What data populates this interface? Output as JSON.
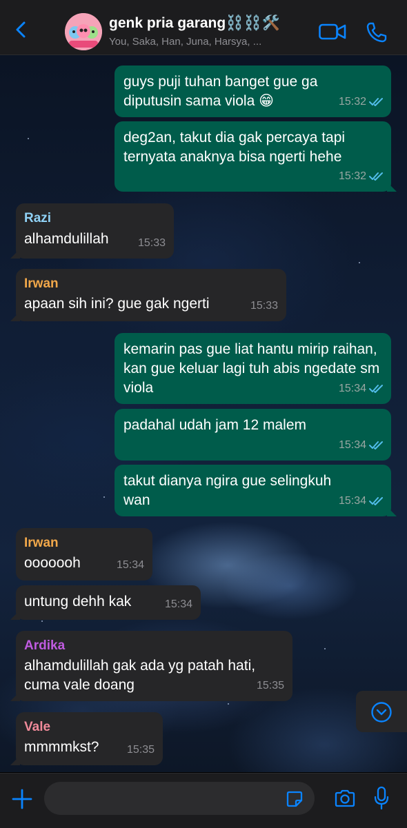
{
  "header": {
    "title": "genk pria garang⛓️⛓️🛠️",
    "subtitle": "You, Saka, Han, Juna, Harsya, ...",
    "icons": [
      "back-chevron-icon",
      "group-avatar",
      "video-call-icon",
      "voice-call-icon"
    ]
  },
  "messages": [
    {
      "dir": "out",
      "text": "guys puji tuhan banget gue ga diputusin sama viola 😁",
      "time": "15:32"
    },
    {
      "dir": "out",
      "text": "deg2an, takut dia gak percaya tapi ternyata anaknya bisa ngerti hehe",
      "time": "15:32"
    },
    {
      "dir": "in",
      "sender": "Razi",
      "text": "alhamdulillah",
      "time": "15:33"
    },
    {
      "dir": "in",
      "sender": "Irwan",
      "text": "apaan sih ini? gue gak ngerti",
      "time": "15:33"
    },
    {
      "dir": "out",
      "text": "kemarin pas gue liat hantu mirip raihan, kan gue keluar lagi tuh abis ngedate sm viola",
      "time": "15:34"
    },
    {
      "dir": "out",
      "text": "padahal udah jam 12 malem",
      "time": "15:34"
    },
    {
      "dir": "out",
      "text": "takut dianya ngira gue selingkuh wan",
      "time": "15:34"
    },
    {
      "dir": "in",
      "sender": "Irwan",
      "text": "ooooooh",
      "time": "15:34"
    },
    {
      "dir": "in",
      "text": "untung dehh kak",
      "time": "15:34"
    },
    {
      "dir": "in",
      "sender": "Ardika",
      "text": "alhamdulillah gak ada yg patah hati, cuma vale doang",
      "time": "15:35"
    },
    {
      "dir": "in",
      "sender": "Vale",
      "text": "mmmmkst?",
      "time": "15:35"
    }
  ],
  "colors": {
    "accent": "#0a84ff",
    "outgoing_bubble": "#005c4b",
    "incoming_bubble": "#262628",
    "read_tick": "#53bdeb",
    "sender_razi": "#8fd1f5",
    "sender_irwan": "#f2a84a",
    "sender_ardika": "#c05be0",
    "sender_vale": "#f08a9a"
  },
  "input": {
    "placeholder": "",
    "icons": [
      "plus-icon",
      "sticker-icon",
      "camera-icon",
      "microphone-icon"
    ]
  }
}
